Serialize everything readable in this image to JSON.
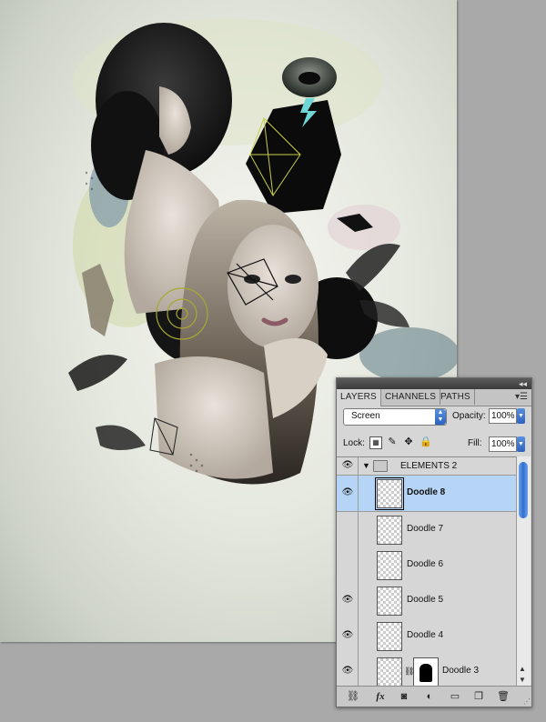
{
  "panel": {
    "tabs": [
      {
        "label": "LAYERS",
        "active": true
      },
      {
        "label": "CHANNELS",
        "active": false
      },
      {
        "label": "PATHS",
        "active": false
      }
    ],
    "blend_mode": "Screen",
    "opacity_label": "Opacity:",
    "opacity_value": "100%",
    "lock_label": "Lock:",
    "fill_label": "Fill:",
    "fill_value": "100%",
    "group": {
      "name": "ELEMENTS 2",
      "expanded": true
    },
    "layers": [
      {
        "name": "Doodle 8",
        "visible": true,
        "selected": true,
        "mask": false
      },
      {
        "name": "Doodle 7",
        "visible": false,
        "selected": false,
        "mask": false
      },
      {
        "name": "Doodle 6",
        "visible": false,
        "selected": false,
        "mask": false
      },
      {
        "name": "Doodle 5",
        "visible": true,
        "selected": false,
        "mask": false
      },
      {
        "name": "Doodle 4",
        "visible": true,
        "selected": false,
        "mask": false
      },
      {
        "name": "Doodle 3",
        "visible": true,
        "selected": false,
        "mask": true
      }
    ],
    "bottom_icons": [
      "link-icon",
      "fx-icon",
      "mask-icon",
      "adjustment-icon",
      "group-folder-icon",
      "new-layer-icon",
      "trash-icon"
    ]
  },
  "colors": {
    "selection": "#b6d4f5",
    "aqua": "#2f6fd2",
    "canvas_bg": "#e6e9e0",
    "app_bg": "#a9a9a9"
  }
}
